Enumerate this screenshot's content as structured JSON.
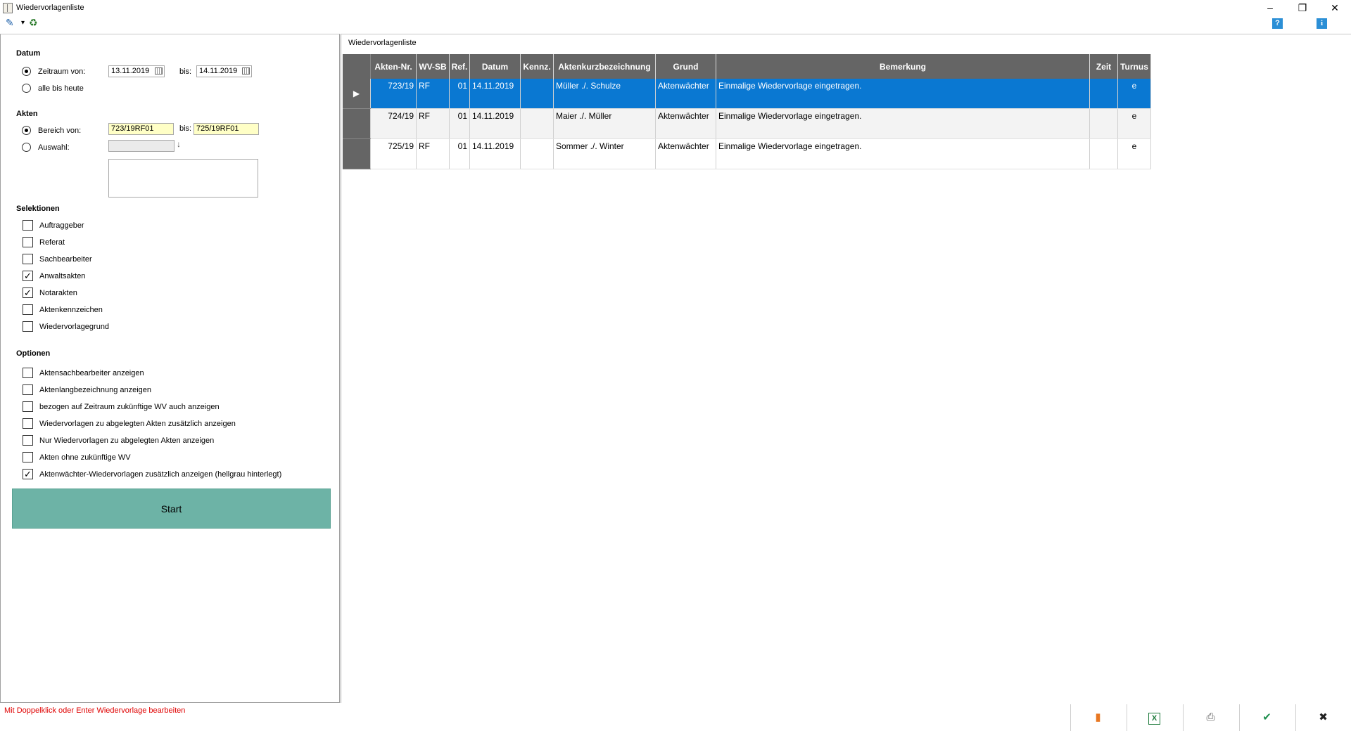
{
  "window": {
    "title": "Wiedervorlagenliste",
    "minimize": "–",
    "restore": "❐",
    "close": "✕"
  },
  "toolbar": {
    "tools_icon": "✎",
    "dropdown_icon": "▾",
    "bin_icon": "♻",
    "help": "?",
    "info": "i"
  },
  "filters": {
    "datum": {
      "heading": "Datum",
      "zeitraum_label": "Zeitraum von:",
      "from": "13.11.2019",
      "bis_label": "bis:",
      "to": "14.11.2019",
      "alle_label": "alle bis heute"
    },
    "akten": {
      "heading": "Akten",
      "bereich_label": "Bereich von:",
      "from": "723/19RF01",
      "bis_label": "bis:",
      "to": "725/19RF01",
      "auswahl_label": "Auswahl:",
      "arrow": "↓"
    },
    "selektionen": {
      "heading": "Selektionen",
      "items": [
        {
          "label": "Auftraggeber",
          "checked": ""
        },
        {
          "label": "Referat",
          "checked": ""
        },
        {
          "label": "Sachbearbeiter",
          "checked": ""
        },
        {
          "label": "Anwaltsakten",
          "checked": "✓"
        },
        {
          "label": "Notarakten",
          "checked": "✓"
        },
        {
          "label": "Aktenkennzeichen",
          "checked": ""
        },
        {
          "label": "Wiedervorlagegrund",
          "checked": ""
        }
      ]
    },
    "optionen": {
      "heading": "Optionen",
      "items": [
        {
          "label": "Aktensachbearbeiter anzeigen",
          "checked": ""
        },
        {
          "label": "Aktenlangbezeichnung anzeigen",
          "checked": ""
        },
        {
          "label": "bezogen auf Zeitraum zukünftige WV auch anzeigen",
          "checked": ""
        },
        {
          "label": "Wiedervorlagen zu abgelegten Akten zusätzlich anzeigen",
          "checked": ""
        },
        {
          "label": "Nur Wiedervorlagen zu abgelegten Akten anzeigen",
          "checked": ""
        },
        {
          "label": "Akten ohne zukünftige WV",
          "checked": ""
        },
        {
          "label": "Aktenwächter-Wiedervorlagen zusätzlich anzeigen (hellgrau hinterlegt)",
          "checked": "✓"
        }
      ]
    },
    "start_label": "Start"
  },
  "list": {
    "caption": "Wiedervorlagenliste",
    "columns": [
      "Akten-Nr.",
      "WV-SB",
      "Ref.",
      "Datum",
      "Kennz.",
      "Aktenkurzbezeichnung",
      "Grund",
      "Bemerkung",
      "Zeit",
      "Turnus"
    ],
    "row_marker": "▶",
    "rows": [
      [
        "723/19",
        "RF",
        "01",
        "14.11.2019",
        "",
        "Müller ./. Schulze",
        "Aktenwächter",
        "Einmalige Wiedervorlage eingetragen.",
        "",
        "e"
      ],
      [
        "724/19",
        "RF",
        "01",
        "14.11.2019",
        "",
        "Maier ./. Müller",
        "Aktenwächter",
        "Einmalige Wiedervorlage eingetragen.",
        "",
        "e"
      ],
      [
        "725/19",
        "RF",
        "01",
        "14.11.2019",
        "",
        "Sommer ./. Winter",
        "Aktenwächter",
        "Einmalige Wiedervorlage eingetragen.",
        "",
        "e"
      ]
    ]
  },
  "status": {
    "message": "Mit Doppelklick oder Enter Wiedervorlage bearbeiten"
  },
  "bottom_buttons": {
    "export_icon": "▮",
    "excel_icon": "X",
    "print_icon": "⎙",
    "ok_icon": "✔",
    "cancel_icon": "✖"
  },
  "colors": {
    "accent_selection": "#0a78d2",
    "start_button": "#6db3a6",
    "status_text": "#e00000",
    "excel": "#1e7b3c",
    "ok": "#1e8f4e",
    "export": "#e87722"
  }
}
